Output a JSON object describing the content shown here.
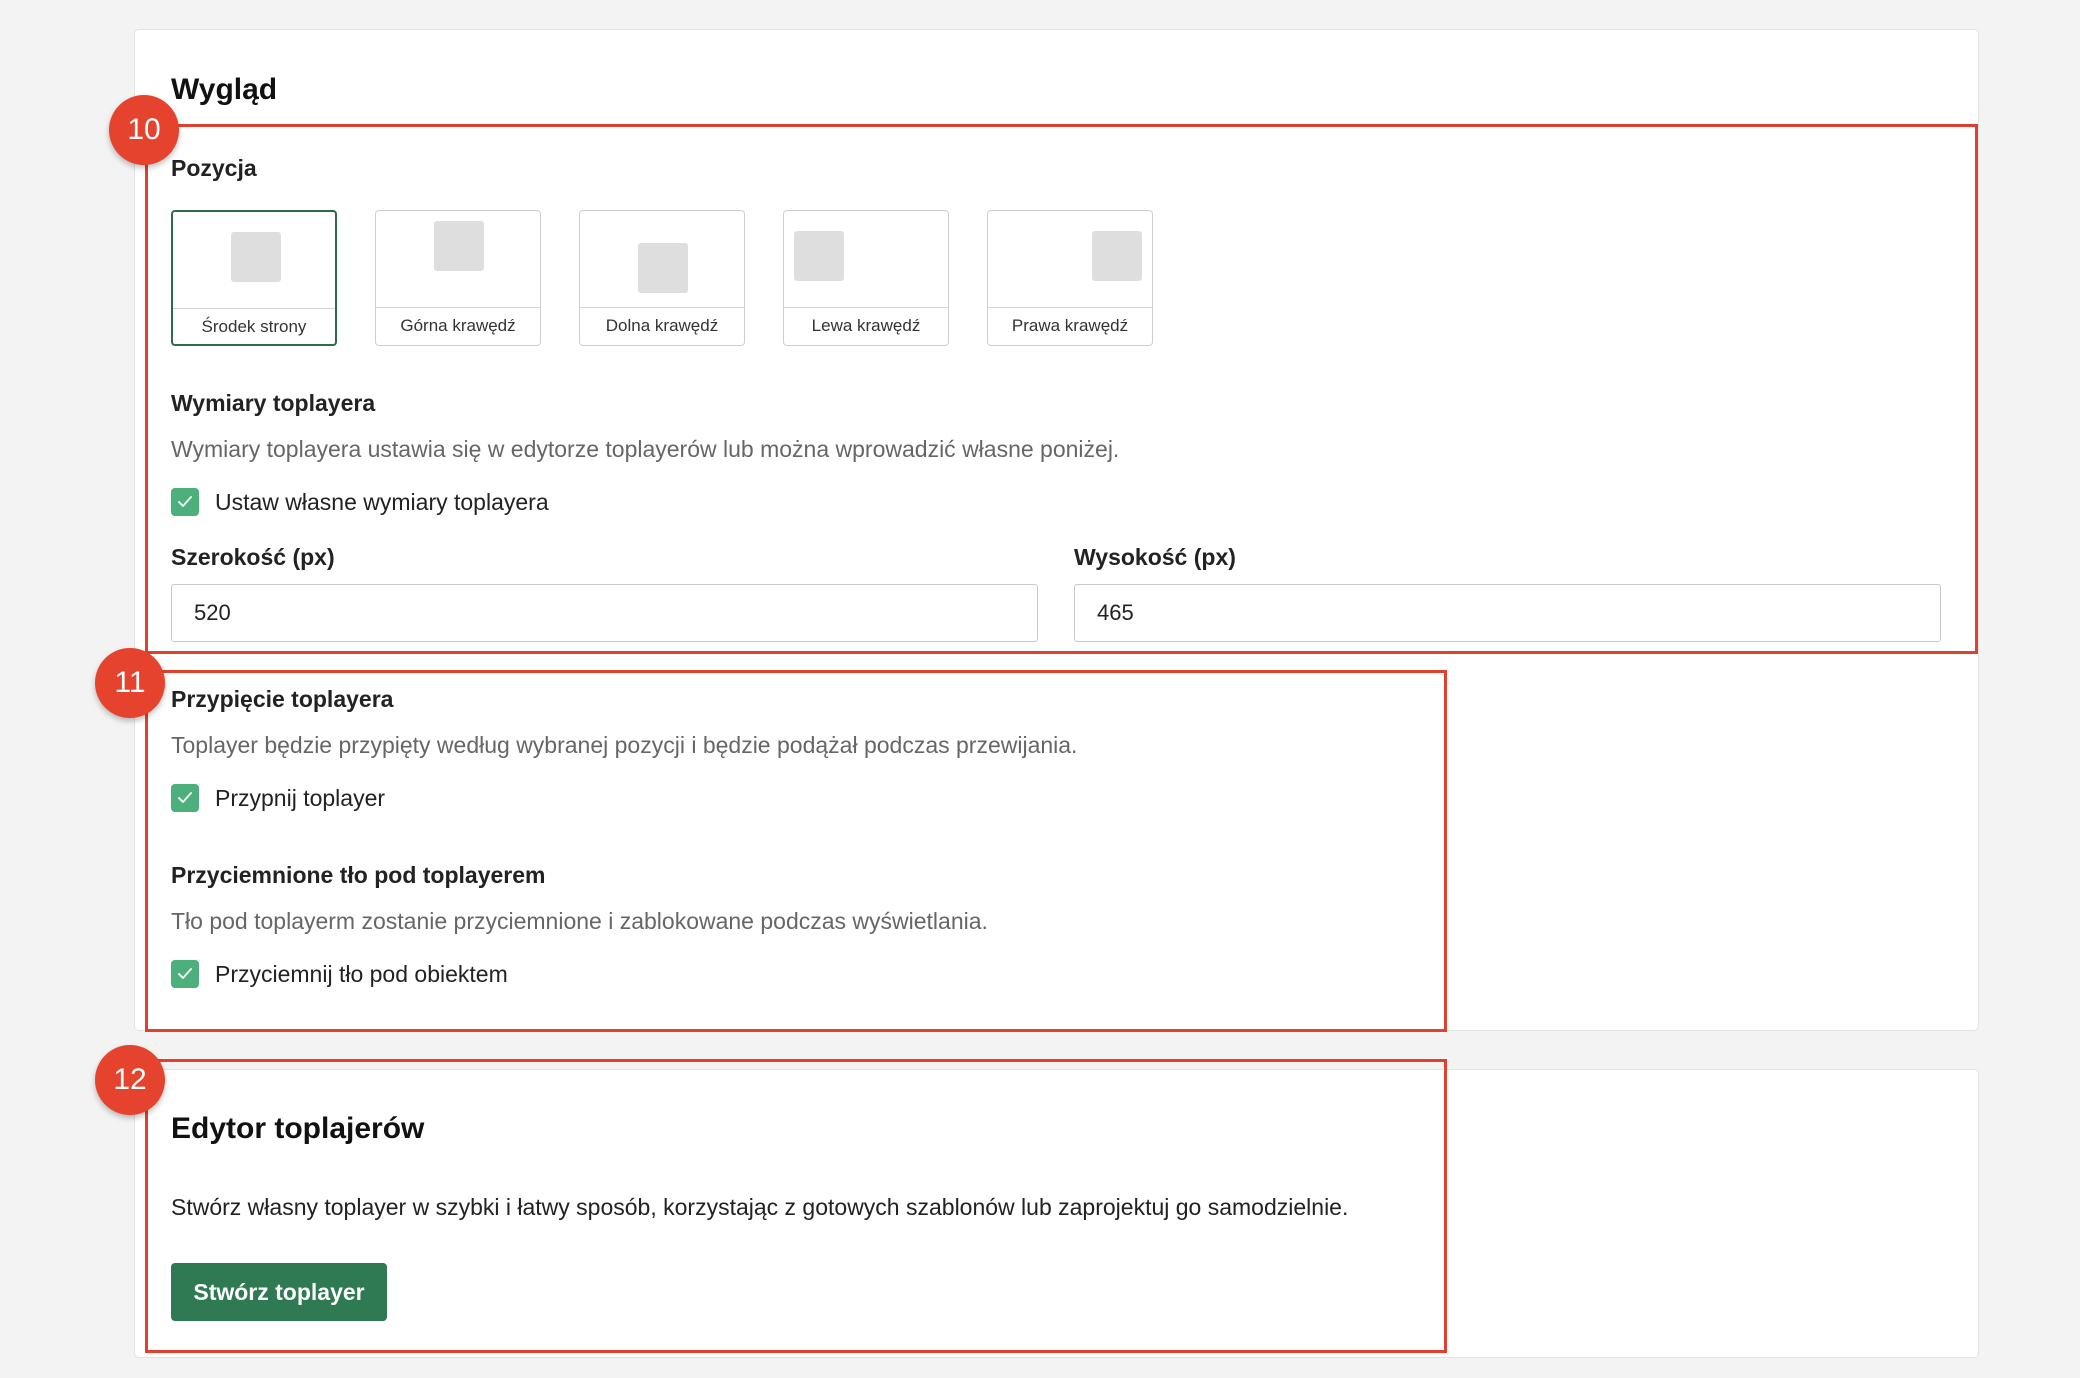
{
  "appearance": {
    "title": "Wygląd",
    "position_heading": "Pozycja",
    "position_options": [
      {
        "label": "Środek strony",
        "selected": true
      },
      {
        "label": "Górna krawędź",
        "selected": false
      },
      {
        "label": "Dolna krawędź",
        "selected": false
      },
      {
        "label": "Lewa krawędź",
        "selected": false
      },
      {
        "label": "Prawa krawędź",
        "selected": false
      }
    ],
    "dimensions": {
      "heading": "Wymiary toplayera",
      "description": "Wymiary toplayera ustawia się w edytorze toplayerów lub można wprowadzić własne poniżej.",
      "custom_checkbox_label": "Ustaw własne wymiary toplayera",
      "custom_checked": true,
      "width_label": "Szerokość (px)",
      "width_value": "520",
      "height_label": "Wysokość (px)",
      "height_value": "465"
    },
    "pinning": {
      "heading": "Przypięcie toplayera",
      "description": "Toplayer będzie przypięty według wybranej pozycji i będzie podążał podczas przewijania.",
      "checkbox_label": "Przypnij toplayer",
      "checked": true
    },
    "dim_background": {
      "heading": "Przyciemnione tło pod toplayerem",
      "description": "Tło pod toplayerm zostanie przyciemnione i zablokowane podczas wyświetlania.",
      "checkbox_label": "Przyciemnij tło pod obiektem",
      "checked": true
    }
  },
  "editor": {
    "title": "Edytor toplajerów",
    "description": "Stwórz własny toplayer w szybki i łatwy sposób, korzystając z gotowych szablonów lub zaprojektuj go samodzielnie.",
    "create_button": "Stwórz toplayer"
  },
  "annotations": [
    "10",
    "11",
    "12"
  ],
  "colors": {
    "accent_green": "#2f7a52",
    "checkbox_green": "#4caf7c",
    "annotation_red": "#e0412e"
  }
}
